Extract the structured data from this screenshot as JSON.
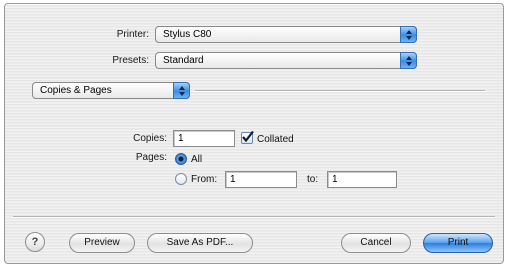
{
  "dialog": {
    "printer": {
      "label": "Printer:",
      "value": "Stylus C80"
    },
    "presets": {
      "label": "Presets:",
      "value": "Standard"
    },
    "section": {
      "value": "Copies & Pages"
    },
    "copies": {
      "label": "Copies:",
      "value": "1",
      "collated_label": "Collated",
      "collated_checked": true
    },
    "pages": {
      "label": "Pages:",
      "all_label": "All",
      "all_selected": true,
      "from_label": "From:",
      "from_value": "1",
      "to_label": "to:",
      "to_value": "1"
    }
  },
  "footer": {
    "help_label": "?",
    "preview_label": "Preview",
    "save_pdf_label": "Save As PDF...",
    "cancel_label": "Cancel",
    "print_label": "Print"
  },
  "colors": {
    "accent_blue": "#3a8ce6",
    "default_button": "#2f7ddd",
    "dialog_background": "#ececec"
  },
  "icons": {
    "popup_arrows": "up-down-arrows-icon",
    "collated_check": "checkmark-icon",
    "help": "question-mark-icon"
  }
}
